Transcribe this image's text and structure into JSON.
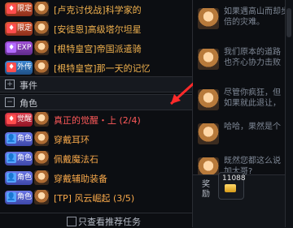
{
  "quest_list": {
    "rows": [
      {
        "badge": "限定",
        "glyph": "♦",
        "glyph_color": "red",
        "title": "[卢克讨伐战]科学家的"
      },
      {
        "badge": "限定",
        "glyph": "♦",
        "glyph_color": "red",
        "title": "[安徒恩]高级塔尔坦星"
      },
      {
        "badge": "EXP",
        "glyph": "♦",
        "glyph_color": "red",
        "title": "[根特皇宫]帝国派遣骑"
      },
      {
        "badge": "外传",
        "glyph": "♦",
        "glyph_color": "red",
        "title": "[根特皇宫]那一天的记忆"
      }
    ],
    "categories": {
      "events": {
        "toggle": "+",
        "label": "事件"
      },
      "roles": {
        "toggle": "−",
        "label": "角色"
      }
    },
    "role_rows": [
      {
        "badge": "觉醒",
        "glyph": "♦",
        "glyph_color": "red",
        "title": "真正的觉醒・上",
        "progress": "(2/4)"
      },
      {
        "badge": "角色",
        "glyph": "👤",
        "glyph_color": "blue",
        "title": "穿戴耳环",
        "progress": ""
      },
      {
        "badge": "角色",
        "glyph": "👤",
        "glyph_color": "blue",
        "title": "佩戴魔法石",
        "progress": ""
      },
      {
        "badge": "角色",
        "glyph": "👤",
        "glyph_color": "blue",
        "title": "穿戴辅助装备",
        "progress": ""
      },
      {
        "badge": "角色",
        "glyph": "👤",
        "glyph_color": "blue",
        "title": "[TP] 风云崛起",
        "progress": "(3/5)"
      }
    ],
    "bottom_filter_label": "只查看推荐任务"
  },
  "chat_panel": {
    "messages": [
      "如果遇高山而却步\n倍的灾难。",
      "我们原本的道路\n也齐心协力击败",
      "尽管你疯狂，但\n如果就此退让，",
      "哈哈，果然是个",
      "既然您都这么说\n加大哥?"
    ],
    "reward_label": "奖励",
    "reward_count": "11088"
  }
}
